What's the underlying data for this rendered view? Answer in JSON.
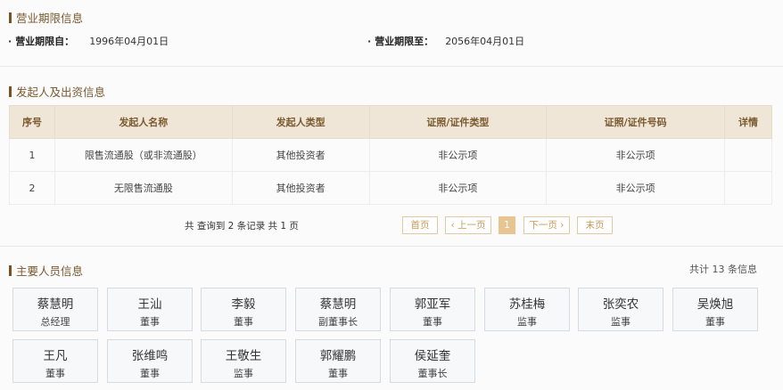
{
  "business_period": {
    "title": "营业期限信息",
    "from_label": "营业期限自：",
    "from_value": "1996年04月01日",
    "to_label": "营业期限至：",
    "to_value": "2056年04月01日"
  },
  "founders": {
    "title": "发起人及出资信息",
    "headers": [
      "序号",
      "发起人名称",
      "发起人类型",
      "证照/证件类型",
      "证照/证件号码",
      "详情"
    ],
    "rows": [
      [
        "1",
        "限售流通股（或非流通股）",
        "其他投资者",
        "非公示项",
        "非公示项",
        ""
      ],
      [
        "2",
        "无限售流通股",
        "其他投资者",
        "非公示项",
        "非公示项",
        ""
      ]
    ],
    "pager_info": "共 查询到 2 条记录 共 1 页",
    "pager": {
      "first": "首页",
      "prev": "‹ 上一页",
      "current": "1",
      "next": "下一页 ›",
      "last": "末页"
    }
  },
  "personnel": {
    "title": "主要人员信息",
    "total": "共计 13 条信息",
    "people": [
      {
        "name": "蔡慧明",
        "role": "总经理"
      },
      {
        "name": "王汕",
        "role": "董事"
      },
      {
        "name": "李毅",
        "role": "董事"
      },
      {
        "name": "蔡慧明",
        "role": "副董事长"
      },
      {
        "name": "郭亚军",
        "role": "董事"
      },
      {
        "name": "苏桂梅",
        "role": "监事"
      },
      {
        "name": "张奕农",
        "role": "监事"
      },
      {
        "name": "吴焕旭",
        "role": "董事"
      },
      {
        "name": "王凡",
        "role": "董事"
      },
      {
        "name": "张维鸣",
        "role": "董事"
      },
      {
        "name": "王敬生",
        "role": "监事"
      },
      {
        "name": "郭耀鹏",
        "role": "董事"
      },
      {
        "name": "侯延奎",
        "role": "董事长"
      }
    ]
  }
}
